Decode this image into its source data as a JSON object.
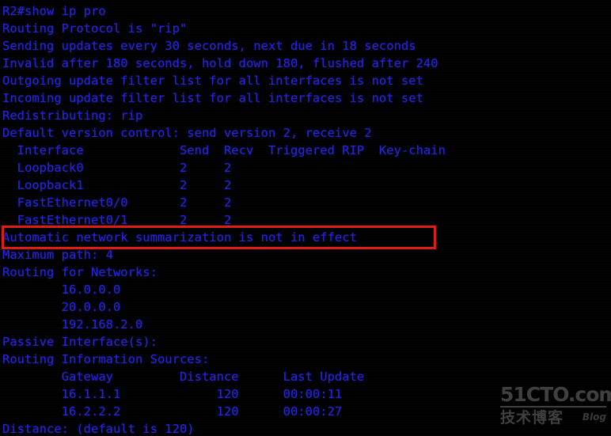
{
  "terminal": {
    "prompt_line": "R2#show ip pro",
    "lines": [
      "R2#show ip pro",
      "Routing Protocol is \"rip\"",
      "Sending updates every 30 seconds, next due in 18 seconds",
      "Invalid after 180 seconds, hold down 180, flushed after 240",
      "Outgoing update filter list for all interfaces is not set",
      "Incoming update filter list for all interfaces is not set",
      "Redistributing: rip",
      "Default version control: send version 2, receive 2",
      "  Interface             Send  Recv  Triggered RIP  Key-chain",
      "  Loopback0             2     2",
      "  Loopback1             2     2",
      "  FastEthernet0/0       2     2",
      "  FastEthernet0/1       2     2",
      "Automatic network summarization is not in effect",
      "Maximum path: 4",
      "Routing for Networks:",
      "        16.0.0.0",
      "        20.0.0.0",
      "        192.168.2.0",
      "Passive Interface(s):",
      "Routing Information Sources:",
      "        Gateway         Distance      Last Update",
      "        16.1.1.1             120      00:00:11",
      "        16.2.2.2             120      00:00:27",
      "Distance: (default is 120)"
    ],
    "highlighted_line_index": 13,
    "highlighted_line_text": "Automatic network summarization is not in effect",
    "colors": {
      "background": "#000000",
      "text": "#2323d6",
      "annotation": "#e01b12",
      "watermark": "#cfcfcf"
    },
    "interface_table": {
      "headers": [
        "Interface",
        "Send",
        "Recv",
        "Triggered RIP",
        "Key-chain"
      ],
      "rows": [
        [
          "Loopback0",
          "2",
          "2",
          "",
          ""
        ],
        [
          "Loopback1",
          "2",
          "2",
          "",
          ""
        ],
        [
          "FastEthernet0/0",
          "2",
          "2",
          "",
          ""
        ],
        [
          "FastEthernet0/1",
          "2",
          "2",
          "",
          ""
        ]
      ]
    },
    "networks": [
      "16.0.0.0",
      "20.0.0.0",
      "192.168.2.0"
    ],
    "routing_information_sources": {
      "headers": [
        "Gateway",
        "Distance",
        "Last Update"
      ],
      "rows": [
        [
          "16.1.1.1",
          "120",
          "00:00:11"
        ],
        [
          "16.2.2.2",
          "120",
          "00:00:27"
        ]
      ]
    },
    "summary": {
      "protocol": "rip",
      "update_interval_seconds": "30",
      "next_due_seconds": "18",
      "invalid_after_seconds": "180",
      "hold_down_seconds": "180",
      "flushed_after_seconds": "240",
      "redistributing": "rip",
      "send_version": "2",
      "receive_version": "2",
      "maximum_path": "4",
      "default_distance": "120"
    }
  },
  "watermark": {
    "top": "51CTO.com",
    "bottom": "技术博客",
    "blog": "Blog"
  }
}
